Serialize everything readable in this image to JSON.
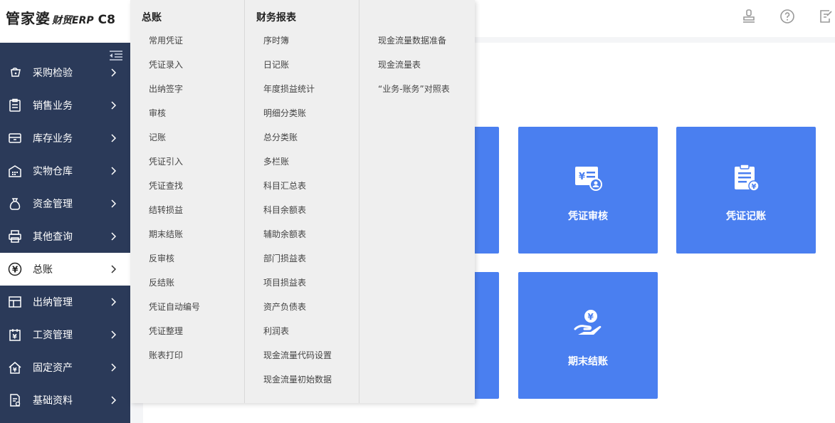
{
  "app": {
    "logo_brand": "管家婆",
    "logo_sub": "财贸ERP",
    "logo_version": "C8"
  },
  "sidebar": {
    "items": [
      {
        "label": "采购检验",
        "icon": "cart-icon",
        "active": false
      },
      {
        "label": "销售业务",
        "icon": "clipboard-icon",
        "active": false
      },
      {
        "label": "库存业务",
        "icon": "inbox-icon",
        "active": false
      },
      {
        "label": "实物仓库",
        "icon": "warehouse-icon",
        "active": false
      },
      {
        "label": "资金管理",
        "icon": "money-bag-icon",
        "active": false
      },
      {
        "label": "其他查询",
        "icon": "printer-icon",
        "active": false
      },
      {
        "label": "总账",
        "icon": "yen-circle-icon",
        "active": true
      },
      {
        "label": "出纳管理",
        "icon": "layout-icon",
        "active": false
      },
      {
        "label": "工资管理",
        "icon": "salary-icon",
        "active": false
      },
      {
        "label": "固定资产",
        "icon": "house-icon",
        "active": false
      },
      {
        "label": "基础资料",
        "icon": "document-icon",
        "active": false
      }
    ]
  },
  "header": {
    "icons": [
      "stamp-icon",
      "help-icon",
      "edit-icon"
    ]
  },
  "dropdown": {
    "columns": [
      {
        "title": "总账",
        "items": [
          "常用凭证",
          "凭证录入",
          "出纳签字",
          "审核",
          "记账",
          "凭证引入",
          "凭证查找",
          "结转损益",
          "期末结账",
          "反审核",
          "反结账",
          "凭证自动编号",
          "凭证整理",
          "账表打印"
        ]
      },
      {
        "title": "财务报表",
        "items": [
          "序时簿",
          "日记账",
          "年度损益统计",
          "明细分类账",
          "总分类账",
          "多栏账",
          "科目汇总表",
          "科目余额表",
          "辅助余额表",
          "部门损益表",
          "项目损益表",
          "资产负债表",
          "利润表",
          "现金流量代码设置",
          "现金流量初始数据"
        ]
      },
      {
        "title": "",
        "items": [
          "现金流量数据准备",
          "现金流量表",
          "“业务-账务”对照表"
        ]
      }
    ]
  },
  "tiles": [
    {
      "label": "凭证审核",
      "icon": "voucher-review-icon"
    },
    {
      "label": "凭证记账",
      "icon": "voucher-post-icon"
    },
    {
      "label": "期末结账",
      "icon": "period-close-icon"
    }
  ],
  "colors": {
    "sidebar_bg": "#2b3a59",
    "tile_blue": "#4a7ff0",
    "dropdown_bg": "#efefef"
  }
}
